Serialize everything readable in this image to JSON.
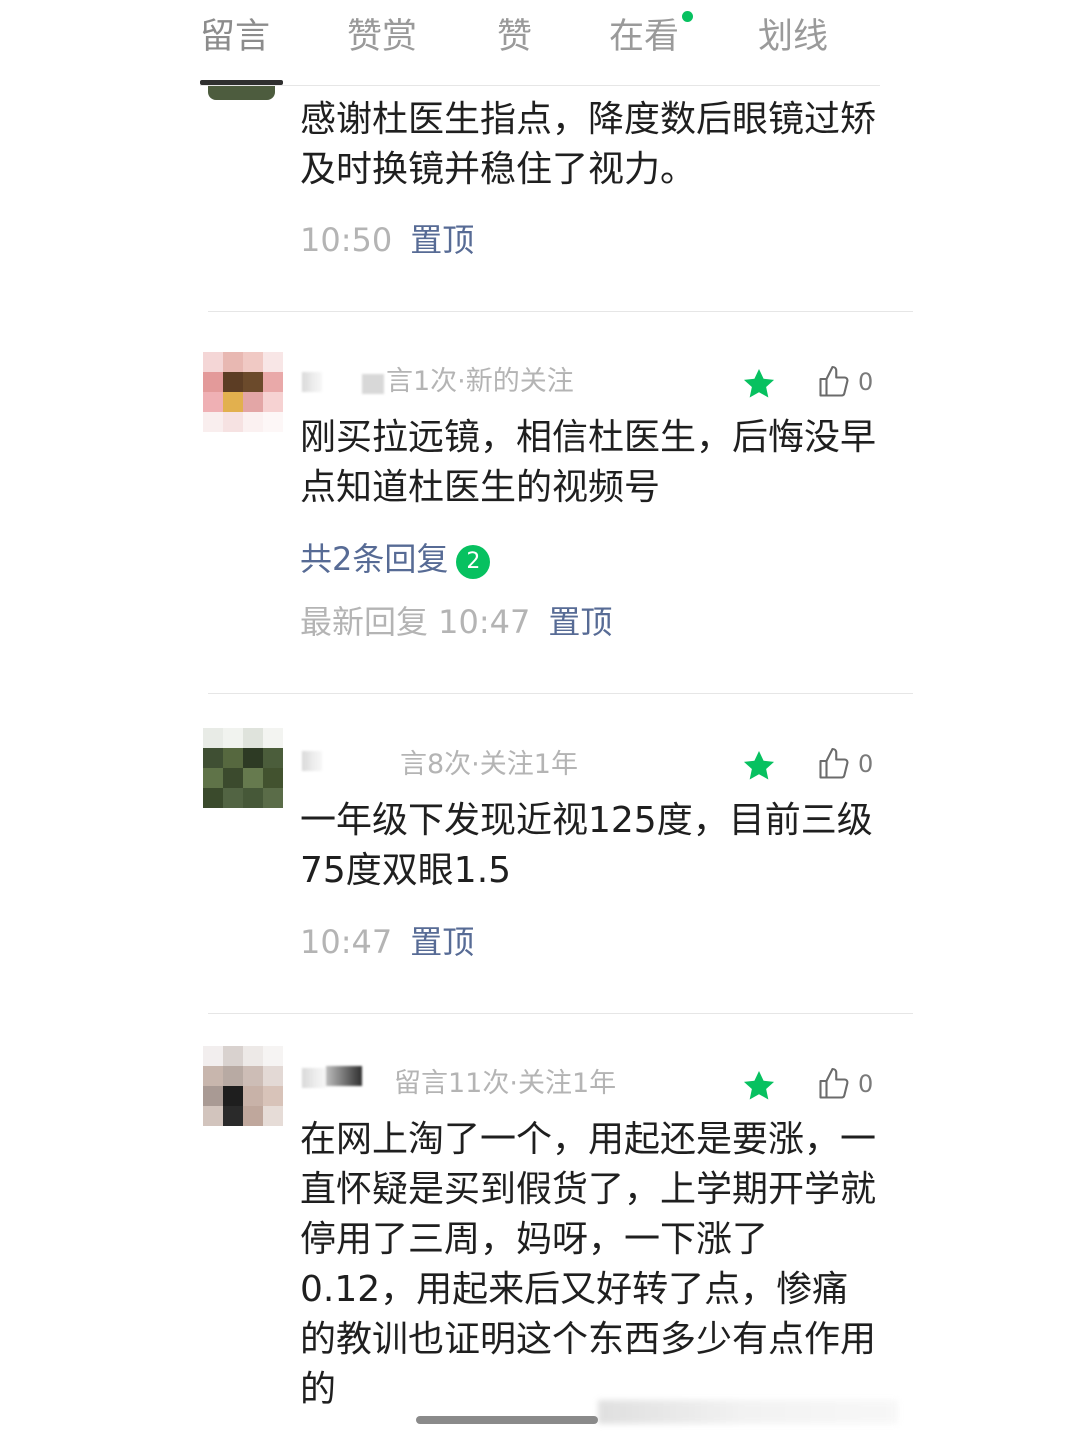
{
  "tabs": [
    {
      "label": "留言",
      "active": true
    },
    {
      "label": "赞赏",
      "active": false
    },
    {
      "label": "赞",
      "active": false
    },
    {
      "label": "在看",
      "active": false,
      "has_new_dot": true
    },
    {
      "label": "划线",
      "active": false
    }
  ],
  "colors": {
    "accent_green": "#07c160",
    "link_blue": "#576b95",
    "meta_gray": "#b4b4b4"
  },
  "comments": [
    {
      "content": "感谢杜医生指点，降度数后眼镜过矫及时换镜并稳住了视力。",
      "time": "10:50",
      "pin_label": "置顶"
    },
    {
      "meta": "言1次·新的关注",
      "starred": true,
      "like_count": "0",
      "content": "刚买拉远镜，相信杜医生，后悔没早点知道杜医生的视频号",
      "replies_label": "共2条回复",
      "replies_badge": "2",
      "time": "最新回复 10:47",
      "pin_label": "置顶"
    },
    {
      "meta": "言8次·关注1年",
      "starred": true,
      "like_count": "0",
      "content": "一年级下发现近视125度，目前三级75度双眼1.5",
      "time": "10:47",
      "pin_label": "置顶"
    },
    {
      "meta": "留言11次·关注1年",
      "starred": true,
      "like_count": "0",
      "content": "在网上淘了一个，用起还是要涨，一直怀疑是买到假货了，上学期开学就停用了三周，妈呀，一下涨了0.12，用起来后又好转了点，惨痛的教训也证明这个东西多少有点作用的"
    }
  ],
  "icons": {
    "star": "star-icon",
    "like": "thumbs-up-icon"
  }
}
